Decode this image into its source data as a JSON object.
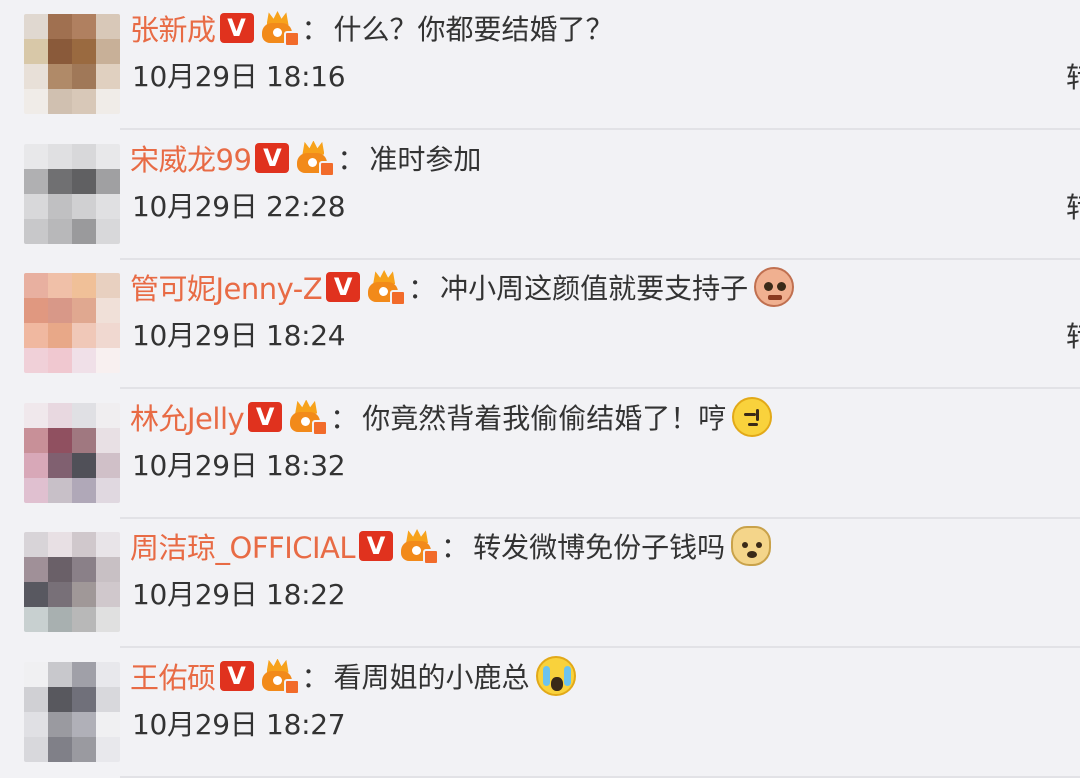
{
  "comments": [
    {
      "username": "张新成",
      "separator": "：",
      "text": "什么？你都要结婚了？",
      "emoji": null,
      "time": "10月29日 18:16",
      "right_action": "转",
      "avatar_colors": [
        "#e0d8d0",
        "#a07050",
        "#b08060",
        "#d8c8b8",
        "#d8c8a8",
        "#8a5a3a",
        "#9a6a40",
        "#c8b098",
        "#e8e0d8",
        "#b08a68",
        "#a07858",
        "#e0d0c0",
        "#f0ece8",
        "#d0c0b0",
        "#d8c8b8",
        "#f0ece8"
      ]
    },
    {
      "username": "宋威龙99",
      "separator": "：",
      "text": "准时参加",
      "emoji": null,
      "time": "10月29日 22:28",
      "right_action": "转",
      "avatar_colors": [
        "#e8e8ea",
        "#e0e0e2",
        "#d8d8da",
        "#e8e8ea",
        "#b0b0b2",
        "#707072",
        "#606062",
        "#a0a0a2",
        "#d8d8da",
        "#c0c0c2",
        "#d0d0d2",
        "#e0e0e2",
        "#c8c8ca",
        "#b8b8ba",
        "#9a9a9c",
        "#d8d8da"
      ]
    },
    {
      "username": "管可妮Jenny-Z",
      "separator": "：",
      "text": "冲小周这颜值就要支持子",
      "emoji": "ugly-face",
      "time": "10月29日 18:24",
      "right_action": "转",
      "avatar_colors": [
        "#e8b0a0",
        "#f0c0a8",
        "#f0c098",
        "#e8d0c0",
        "#e09880",
        "#d89888",
        "#e0a890",
        "#f0e0d8",
        "#f0b8a0",
        "#e8a888",
        "#f0c8b8",
        "#f0d8d0",
        "#f0d0d8",
        "#f0c8d0",
        "#f0e0e8",
        "#f8f0f0"
      ]
    },
    {
      "username": "林允Jelly",
      "separator": "：",
      "text": "你竟然背着我偷偷结婚了！哼",
      "emoji": "hum",
      "time": "10月29日 18:32",
      "right_action": "",
      "avatar_colors": [
        "#f0e8ec",
        "#e8d8e0",
        "#e0e0e4",
        "#f0eef0",
        "#c89098",
        "#905060",
        "#a07880",
        "#e8e0e4",
        "#d8a8b8",
        "#806070",
        "#505058",
        "#d0c0c8",
        "#e0c0d0",
        "#c8c0c8",
        "#b0a8b8",
        "#e0d8e0"
      ]
    },
    {
      "username": "周洁琼_OFFICIAL",
      "separator": "：",
      "text": "转发微博免份子钱吗",
      "emoji": "doge",
      "time": "10月29日 18:22",
      "right_action": "",
      "avatar_colors": [
        "#d8d4d8",
        "#e8e0e4",
        "#d0c8cc",
        "#e8e4e8",
        "#a09098",
        "#6a6068",
        "#8a8088",
        "#c8c0c4",
        "#585860",
        "#787078",
        "#a09898",
        "#d0c8cc",
        "#c8d0d0",
        "#a8b0b0",
        "#b8b8b8",
        "#e0e0e0"
      ]
    },
    {
      "username": "王佑硕",
      "separator": "：",
      "text": "看周姐的小鹿总",
      "emoji": "crying",
      "time": "10月29日 18:27",
      "right_action": "",
      "avatar_colors": [
        "#f0f0f2",
        "#c8c8cc",
        "#a0a0a8",
        "#e8e8ec",
        "#d0d0d4",
        "#58585e",
        "#70707a",
        "#d8d8dc",
        "#e0e0e4",
        "#9a9aa0",
        "#b0b0b8",
        "#f0f0f2",
        "#d8d8dc",
        "#808088",
        "#9a9aa0",
        "#e8e8ec"
      ]
    }
  ],
  "badges": {
    "verified_label": "V",
    "verified_color": "#e0321e",
    "crown_color": "#f28a1a"
  },
  "colors": {
    "username": "#e86b45",
    "text": "#333333",
    "background": "#f2f2f5",
    "divider": "#e2e2e6"
  }
}
